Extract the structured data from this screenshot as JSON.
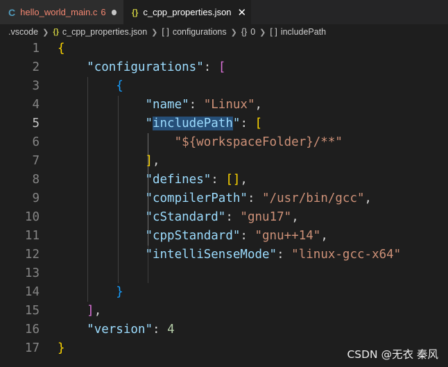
{
  "tabs": [
    {
      "icon": "C",
      "label": "hello_world_main.c",
      "badge": "6"
    },
    {
      "icon": "{}",
      "label": "c_cpp_properties.json",
      "close": "✕"
    }
  ],
  "breadcrumb": {
    "folder": ".vscode",
    "file_icon": "{}",
    "file": "c_cpp_properties.json",
    "array_icon": "[ ]",
    "configurations": "configurations",
    "object_icon": "{}",
    "index": "0",
    "array_icon2": "[ ]",
    "include_path": "includePath"
  },
  "line_numbers": [
    "1",
    "2",
    "3",
    "4",
    "5",
    "6",
    "7",
    "8",
    "9",
    "10",
    "11",
    "12",
    "13",
    "14",
    "15",
    "16",
    "17"
  ],
  "code": {
    "l1_brace": "{",
    "configurations_key": "\"configurations\"",
    "l2_colon": ": ",
    "l2_bracket": "[",
    "l3_brace": "{",
    "name_key": "\"name\"",
    "name_value": "\"Linux\"",
    "include_open_quote": "\"",
    "include_key_text": "includePath",
    "include_close_quote": "\"",
    "l5_bracket": "[",
    "include_value": "\"${workspaceFolder}/**\"",
    "l7_close": "]",
    "defines_key": "\"defines\"",
    "defines_value": "[]",
    "compiler_key": "\"compilerPath\"",
    "compiler_value": "\"/usr/bin/gcc\"",
    "cstd_key": "\"cStandard\"",
    "cstd_value": "\"gnu17\"",
    "cppstd_key": "\"cppStandard\"",
    "cppstd_value": "\"gnu++14\"",
    "intellisense_key": "\"intelliSenseMode\"",
    "intellisense_value": "\"linux-gcc-x64\"",
    "l14_brace": "}",
    "l15_close": "]",
    "version_key": "\"version\"",
    "version_value": "4",
    "l17_brace": "}",
    "colon": ": ",
    "comma": ","
  },
  "watermark": "CSDN @无衣 秦风",
  "colors": {
    "background": "#1e1e1e",
    "key": "#9cdcfe",
    "string": "#ce9178",
    "number": "#b5cea8",
    "bracket_level1": "#ffd700",
    "bracket_level2": "#da70d6",
    "bracket_level3": "#179fff",
    "selection": "#264f78",
    "modified": "#f48771"
  }
}
